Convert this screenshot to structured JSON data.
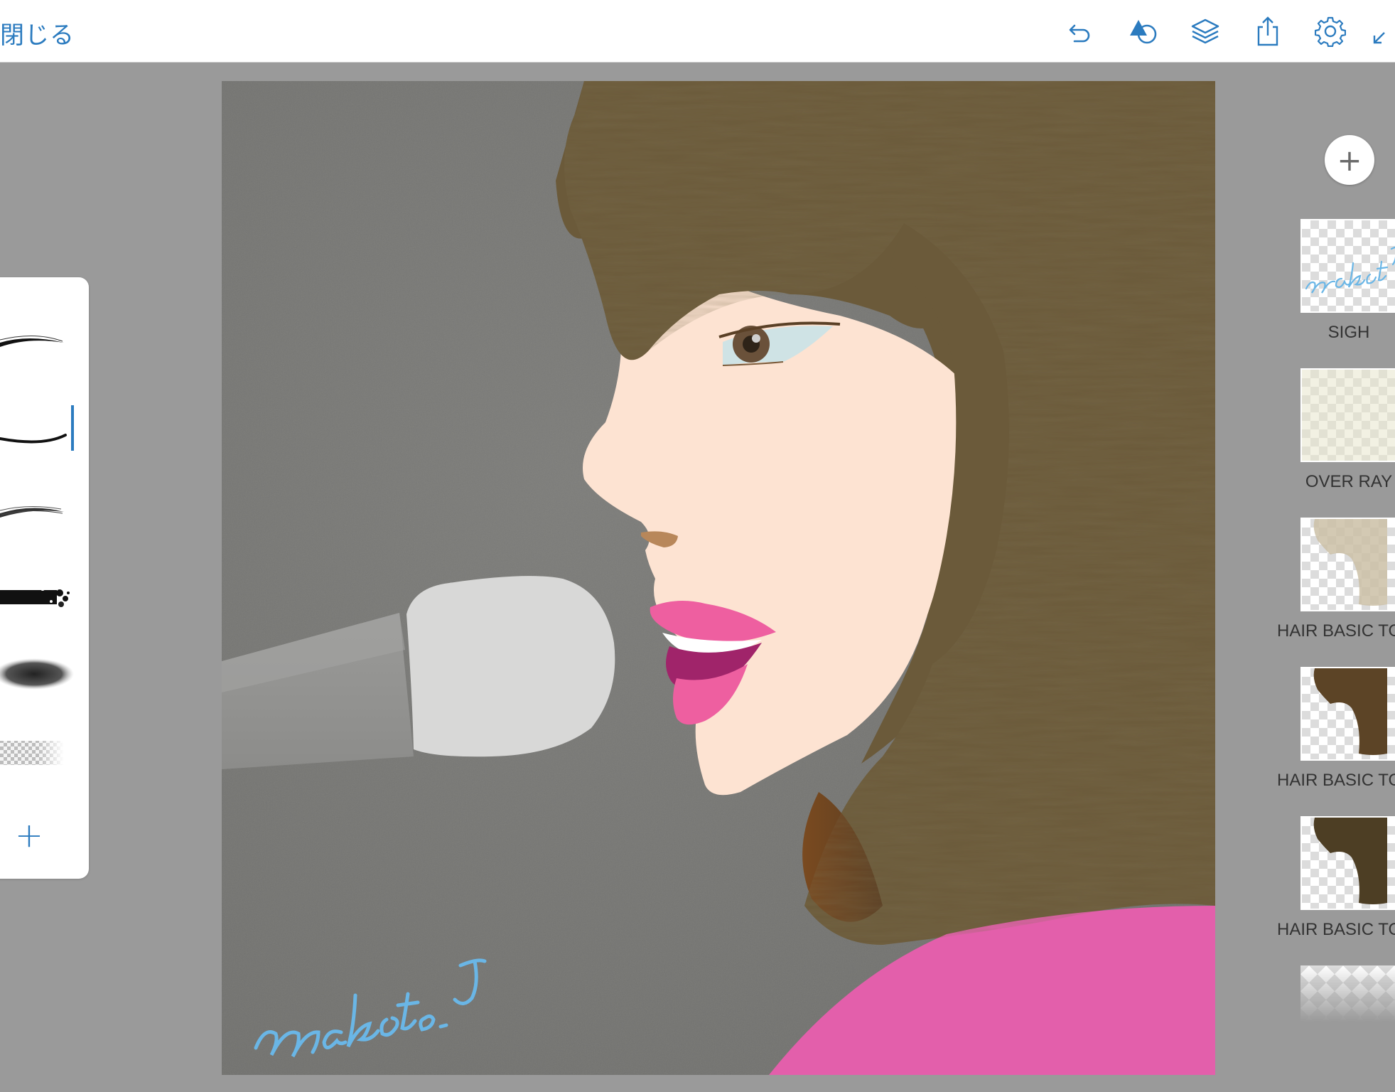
{
  "header": {
    "close_label": "閉じる"
  },
  "toolbar": {
    "icons": [
      "undo-icon",
      "shapes-icon",
      "layers-icon",
      "share-icon",
      "settings-icon",
      "collapse-icon"
    ]
  },
  "brushes": {
    "items": [
      "brush-fine-taper",
      "brush-line",
      "brush-dry",
      "brush-grunge",
      "brush-soft",
      "brush-eraser"
    ],
    "selected_index": 1,
    "add_label": "+"
  },
  "canvas": {
    "signature": "makoto_J"
  },
  "layers": {
    "add_label": "+",
    "items": [
      {
        "name": "SIGH"
      },
      {
        "name": "OVER RAY"
      },
      {
        "name": "HAIR BASIC TO"
      },
      {
        "name": "HAIR BASIC TO"
      },
      {
        "name": "HAIR BASIC TO"
      }
    ]
  },
  "colors": {
    "accent": "#2b7bbf",
    "hair": "#6b5a3a",
    "skin": "#fde3d2",
    "lips": "#ee5fa0",
    "shirt": "#e35fab",
    "background": "#777774",
    "signature": "#6ab6e6"
  }
}
